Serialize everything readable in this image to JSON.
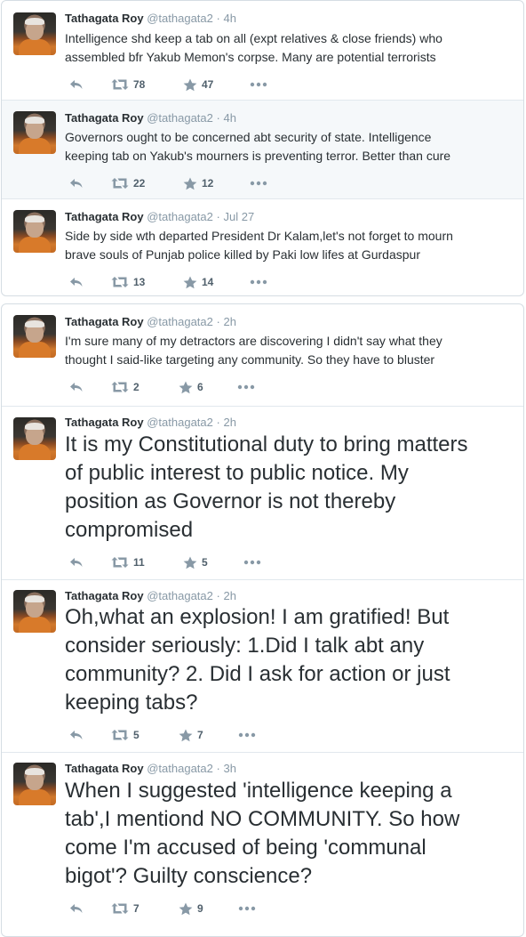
{
  "tweets": [
    {
      "name": "Tathagata Roy",
      "handle": "@tathagata2",
      "time": "4h",
      "lines": [
        "Intelligence shd keep a tab on all (expt relatives & close friends) who",
        "assembled bfr Yakub Memon's corpse. Many are potential terrorists"
      ],
      "retweets": "78",
      "favorites": "47"
    },
    {
      "name": "Tathagata Roy",
      "handle": "@tathagata2",
      "time": "4h",
      "lines": [
        "Governors ought to be concerned abt security of state. Intelligence",
        "keeping tab on Yakub's mourners is preventing terror. Better than cure"
      ],
      "retweets": "22",
      "favorites": "12"
    },
    {
      "name": "Tathagata Roy",
      "handle": "@tathagata2",
      "time": "Jul 27",
      "lines": [
        "Side by side wth departed President Dr Kalam,let's not forget to mourn",
        "brave souls of Punjab police killed by Paki low lifes at Gurdaspur"
      ],
      "retweets": "13",
      "favorites": "14"
    },
    {
      "name": "Tathagata Roy",
      "handle": "@tathagata2",
      "time": "2h",
      "lines": [
        "I'm sure many of my detractors are discovering I didn't say what they",
        "thought I said-like targeting any community. So they have to bluster"
      ],
      "retweets": "2",
      "favorites": "6"
    },
    {
      "name": "Tathagata Roy",
      "handle": "@tathagata2",
      "time": "2h",
      "lines": [
        "It is my Constitutional duty to bring matters",
        "of public interest to public notice. My",
        "position as Governor is not thereby",
        "compromised"
      ],
      "retweets": "11",
      "favorites": "5"
    },
    {
      "name": "Tathagata Roy",
      "handle": "@tathagata2",
      "time": "2h",
      "lines": [
        "Oh,what an explosion! I am gratified! But",
        "consider seriously: 1.Did I talk abt any",
        "community? 2. Did I ask for action or just",
        "keeping tabs?"
      ],
      "retweets": "5",
      "favorites": "7"
    },
    {
      "name": "Tathagata Roy",
      "handle": "@tathagata2",
      "time": "3h",
      "lines": [
        "When I suggested 'intelligence keeping a",
        "tab',I mentiond NO COMMUNITY. So how",
        "come I'm accused of being 'communal",
        "bigot'? Guilty conscience?"
      ],
      "retweets": "7",
      "favorites": "9"
    }
  ],
  "icons": {
    "reply": "reply-icon",
    "retweet": "retweet-icon",
    "favorite": "star-icon",
    "more": "more-icon"
  },
  "colors": {
    "name": "#292f33",
    "meta": "#8899a6",
    "action_icon": "#8899a6",
    "highlight_bg": "#f5f8fa",
    "border": "#e1e8ed"
  }
}
